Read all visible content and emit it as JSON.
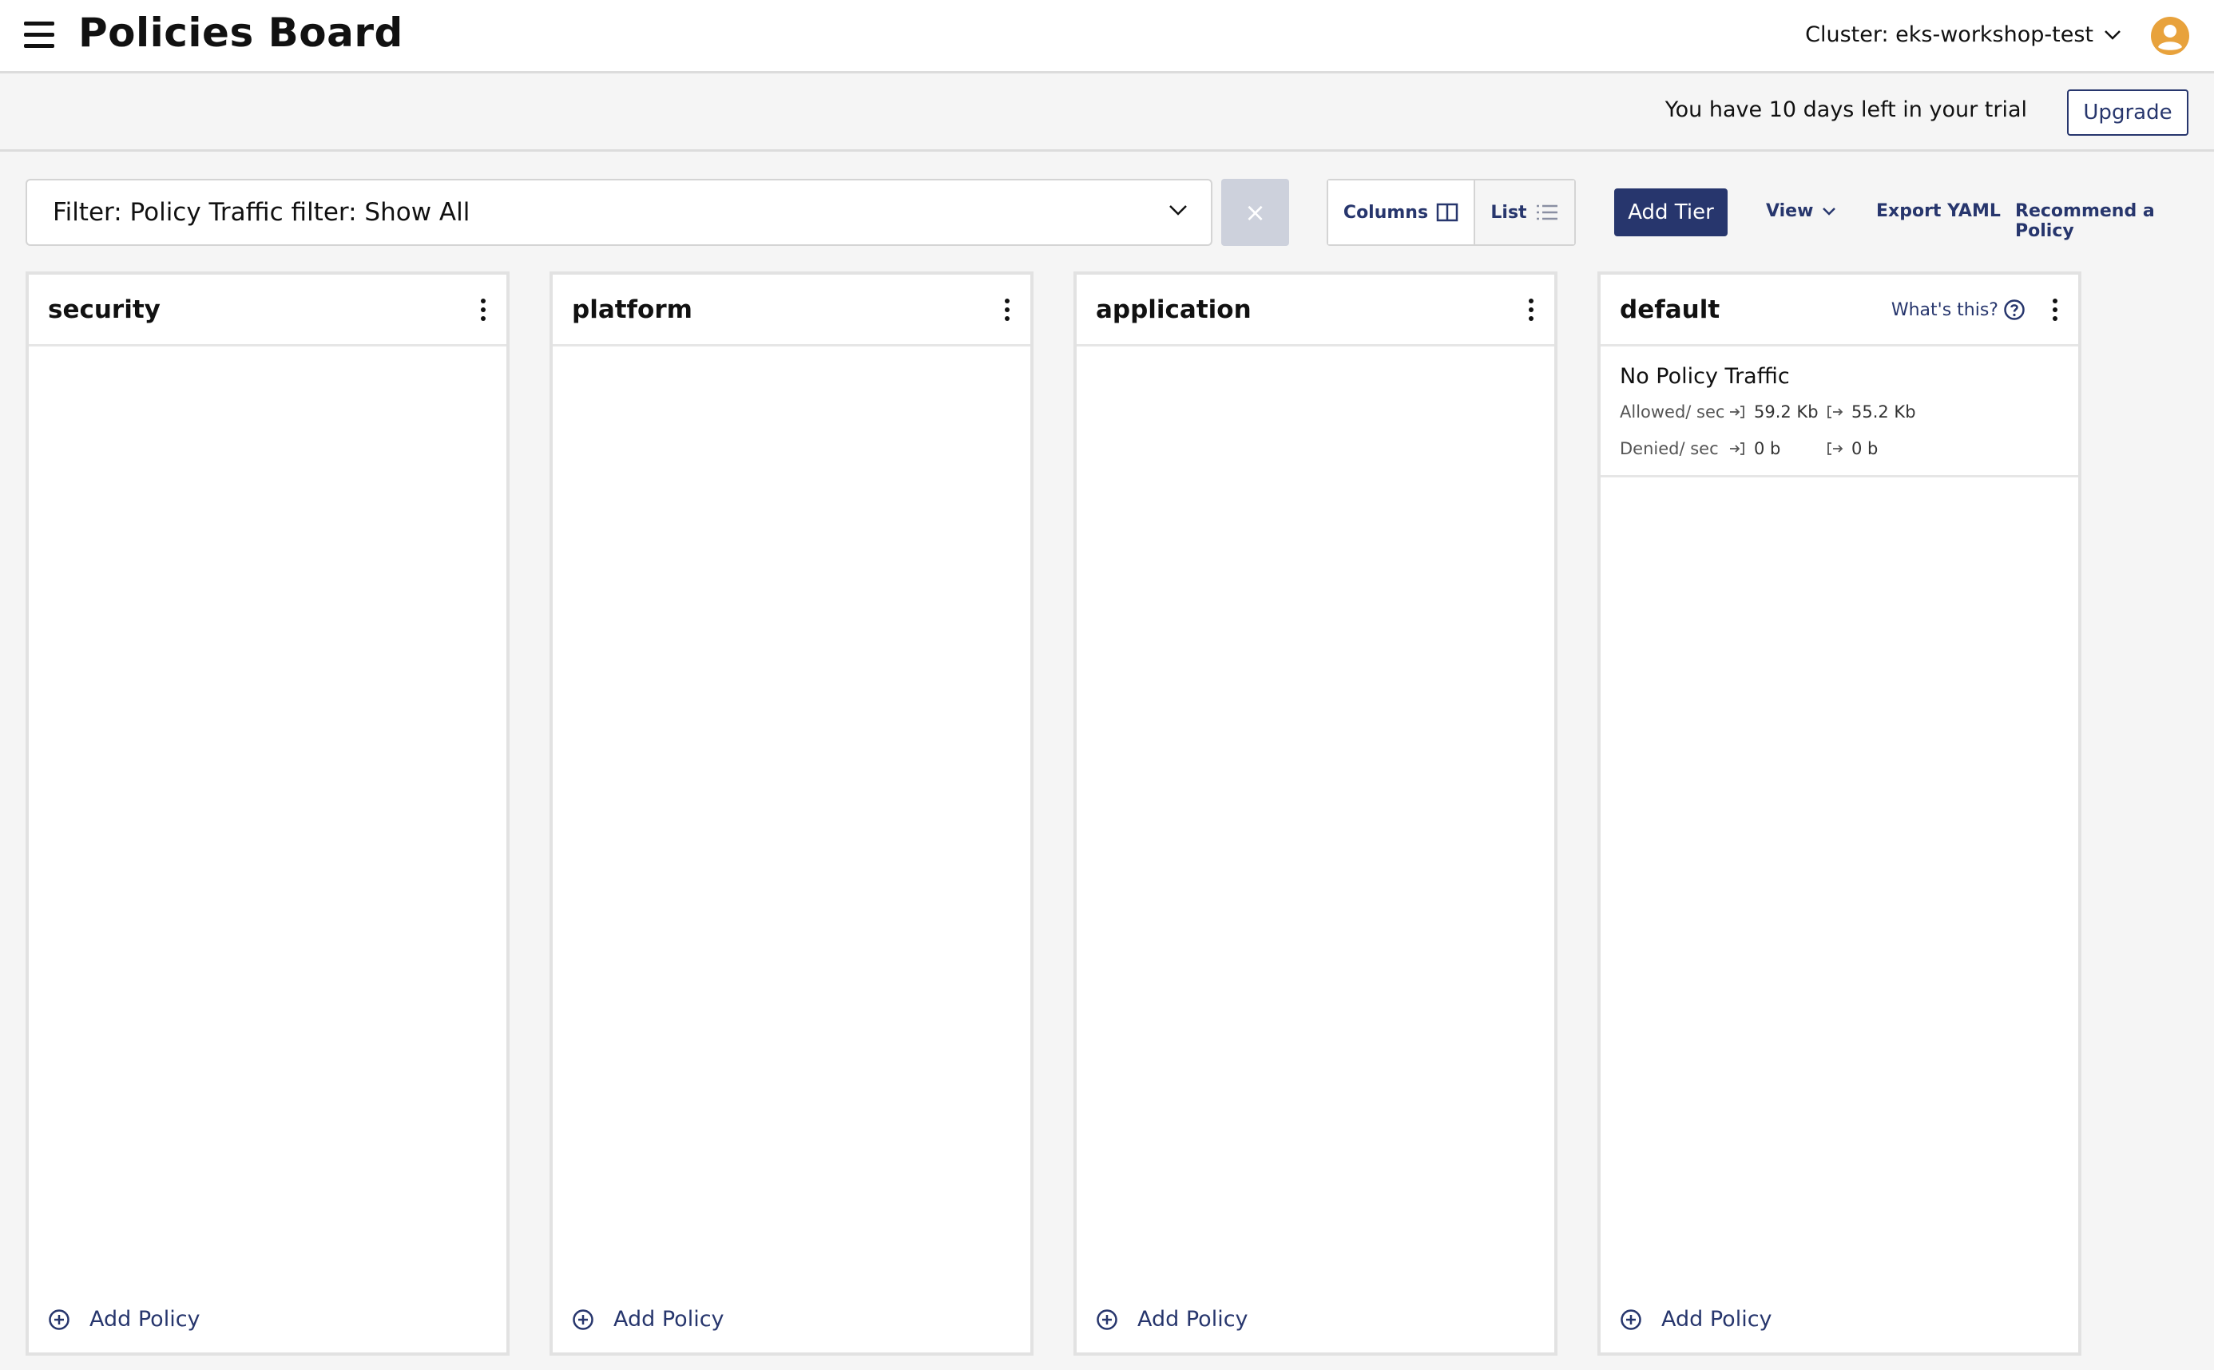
{
  "header": {
    "title": "Policies Board",
    "cluster_label": "Cluster: eks-workshop-test"
  },
  "trial": {
    "message": "You have 10 days left in your trial",
    "upgrade_label": "Upgrade"
  },
  "toolbar": {
    "filter_text": "Filter: Policy Traffic filter: Show All",
    "clear_label": "×",
    "columns_label": "Columns",
    "list_label": "List",
    "add_tier_label": "Add Tier",
    "view_label": "View",
    "export_label": "Export YAML",
    "recommend_label": "Recommend a Policy"
  },
  "tiers": [
    {
      "name": "security",
      "add_policy_label": "Add Policy"
    },
    {
      "name": "platform",
      "add_policy_label": "Add Policy"
    },
    {
      "name": "application",
      "add_policy_label": "Add Policy"
    },
    {
      "name": "default",
      "whats_this_label": "What's this?",
      "add_policy_label": "Add Policy",
      "traffic": {
        "title": "No Policy Traffic",
        "allowed_label": "Allowed/ sec",
        "allowed_in": "59.2 Kb",
        "allowed_out": "55.2 Kb",
        "denied_label": "Denied/ sec",
        "denied_in": "0 b",
        "denied_out": "0 b"
      }
    }
  ],
  "colors": {
    "accent": "#27366d",
    "avatar": "#e8a23c"
  },
  "icons": [
    "menu-icon",
    "chevron-down-icon",
    "user-avatar-icon",
    "columns-icon",
    "list-icon",
    "kebab-icon",
    "help-icon",
    "plus-circle-icon",
    "ingress-icon",
    "egress-icon"
  ]
}
